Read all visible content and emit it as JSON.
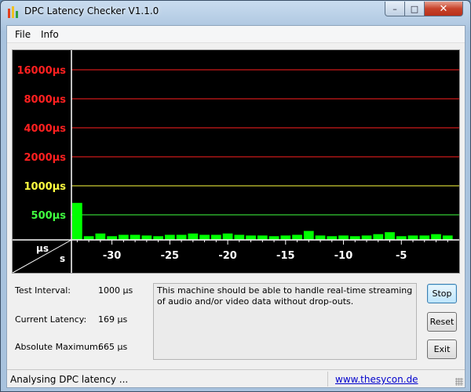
{
  "window": {
    "title": "DPC Latency Checker V1.1.0",
    "min_label": "–",
    "max_label": "□",
    "close_label": "✕"
  },
  "menu": {
    "file": "File",
    "info": "Info"
  },
  "chart_data": {
    "type": "bar",
    "title": "",
    "xlabel": "s",
    "ylabel": "µs",
    "y_scale": "log2",
    "y_tick_labels": [
      "16000µs",
      "8000µs",
      "4000µs",
      "2000µs",
      "1000µs",
      "500µs"
    ],
    "y_ticks": [
      16000,
      8000,
      4000,
      2000,
      1000,
      500
    ],
    "y_tick_colors": [
      "#ff2020",
      "#ff2020",
      "#ff2020",
      "#ff2020",
      "#ffff40",
      "#40ff40"
    ],
    "x_tick_labels": [
      "-30",
      "-25",
      "-20",
      "-15",
      "-10",
      "-5"
    ],
    "x_ticks": [
      -30,
      -25,
      -20,
      -15,
      -10,
      -5
    ],
    "xlim": [
      -33.5,
      0
    ],
    "ylim": [
      250,
      24000
    ],
    "bar_color": "#00ff00",
    "grid": true,
    "x": [
      -33,
      -32,
      -31,
      -30,
      -29,
      -28,
      -27,
      -26,
      -25,
      -24,
      -23,
      -22,
      -21,
      -20,
      -19,
      -18,
      -17,
      -16,
      -15,
      -14,
      -13,
      -12,
      -11,
      -10,
      -9,
      -8,
      -7,
      -6,
      -5,
      -4,
      -3,
      -2,
      -1
    ],
    "values": [
      665,
      300,
      320,
      300,
      310,
      310,
      305,
      300,
      310,
      310,
      320,
      310,
      310,
      320,
      310,
      305,
      305,
      300,
      305,
      310,
      340,
      305,
      300,
      305,
      300,
      305,
      315,
      330,
      300,
      305,
      305,
      315,
      305
    ]
  },
  "info": {
    "test_interval_label": "Test Interval:",
    "test_interval_value": "1000 µs",
    "current_latency_label": "Current Latency:",
    "current_latency_value": "169 µs",
    "absolute_max_label": "Absolute Maximum:",
    "absolute_max_value": "665 µs",
    "message": "This machine should be able to handle real-time streaming of audio and/or video data without drop-outs."
  },
  "buttons": {
    "stop": "Stop",
    "reset": "Reset",
    "exit": "Exit"
  },
  "status": {
    "text": "Analysing DPC latency ...",
    "link": "www.thesycon.de"
  }
}
